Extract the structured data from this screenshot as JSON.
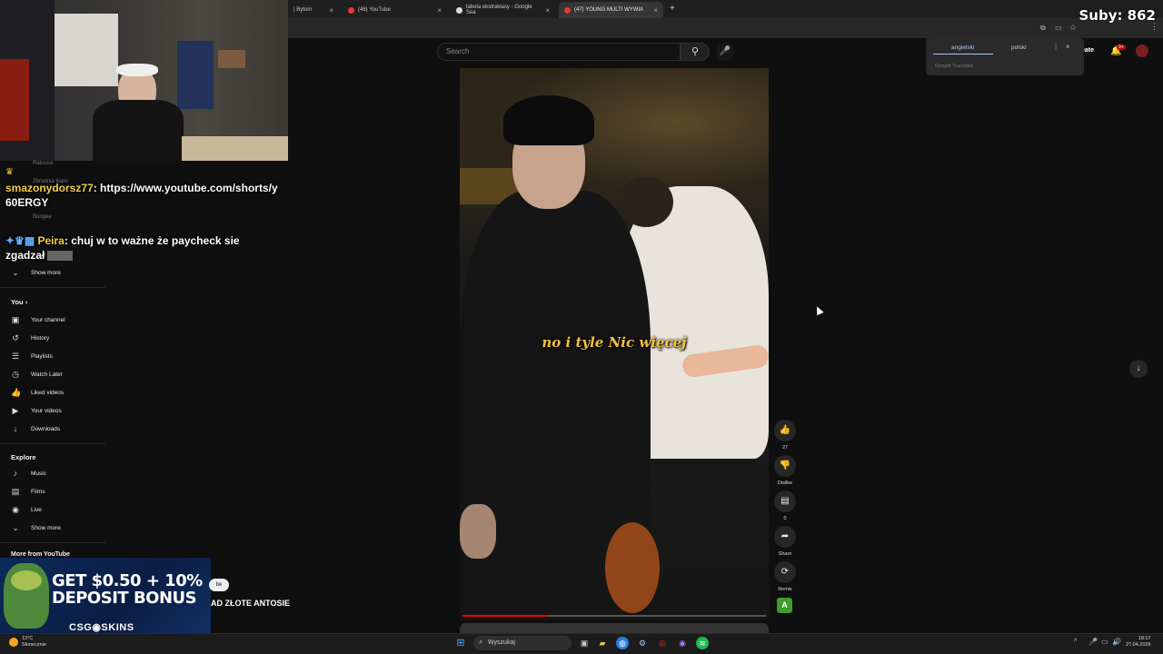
{
  "stream": {
    "subs_label": "Suby: 862"
  },
  "tabs": [
    {
      "title": "| Bytom"
    },
    {
      "title": "(46) YouTube"
    },
    {
      "title": "tabela ekstraklasy - Google Sea"
    },
    {
      "title": "(47) YOUNG MULTI WYWIA"
    }
  ],
  "translate": {
    "lang_from": "angielski",
    "lang_to": "polski",
    "footer": "Google Translate"
  },
  "youtube": {
    "search_placeholder": "Search",
    "create_label": "eate",
    "notif_count": "9+"
  },
  "chat": [
    {
      "user": "smazonydorsz77",
      "message": "https://www.youtube.com/shorts/y",
      "message_cont": "60ERGY"
    },
    {
      "user": "Peira",
      "message": "chuj w to ważne że paycheck sie",
      "message_cont": "zgadzał"
    }
  ],
  "faded_subs": [
    "Ratousa",
    "Zbrodnia Ikaro",
    "Bungee"
  ],
  "sidebar": {
    "show_more_top": "Show more",
    "you_heading": "You",
    "you_items": [
      {
        "label": "Your channel",
        "icon": "channel-icon"
      },
      {
        "label": "History",
        "icon": "history-icon"
      },
      {
        "label": "Playlists",
        "icon": "playlists-icon"
      },
      {
        "label": "Watch Later",
        "icon": "watch-later-icon"
      },
      {
        "label": "Liked videos",
        "icon": "liked-icon"
      },
      {
        "label": "Your videos",
        "icon": "your-videos-icon"
      },
      {
        "label": "Downloads",
        "icon": "downloads-icon"
      }
    ],
    "explore_heading": "Explore",
    "explore_items": [
      {
        "label": "Music",
        "icon": "music-icon"
      },
      {
        "label": "Films",
        "icon": "films-icon"
      },
      {
        "label": "Live",
        "icon": "live-icon"
      }
    ],
    "show_more_bottom": "Show more",
    "more_heading": "More from YouTube"
  },
  "video": {
    "caption": "no i tyle Nic więcej",
    "progress_fraction": 0.28
  },
  "actions": {
    "like_count": "27",
    "dislike_label": "Dislike",
    "comment_count": "0",
    "share_label": "Share",
    "remix_label": "Remix",
    "remix_letter": "A"
  },
  "ad": {
    "line1": "GET $0.50 + 10%",
    "line2": "DEPOSIT BONUS",
    "brand": "CSG◉SKINS",
    "tail_text": "AD ZŁOTE ANTOSIE",
    "pill_text": "be"
  },
  "taskbar": {
    "search_label": "Wyszukaj",
    "weather_temp": "13°C",
    "weather_desc": "Słonecznie",
    "time": "18:17",
    "date": "27.04.2026"
  }
}
